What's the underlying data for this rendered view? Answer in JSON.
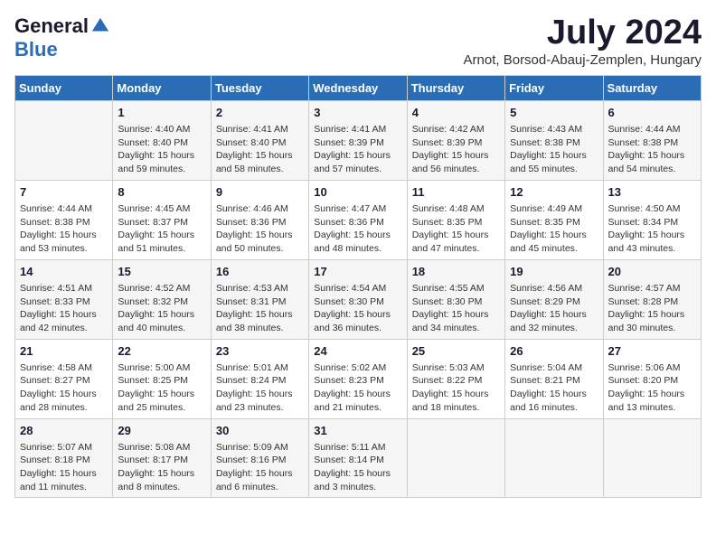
{
  "header": {
    "logo_general": "General",
    "logo_blue": "Blue",
    "month_title": "July 2024",
    "location": "Arnot, Borsod-Abauj-Zemplen, Hungary"
  },
  "days_of_week": [
    "Sunday",
    "Monday",
    "Tuesday",
    "Wednesday",
    "Thursday",
    "Friday",
    "Saturday"
  ],
  "weeks": [
    [
      {
        "day": "",
        "info": ""
      },
      {
        "day": "1",
        "info": "Sunrise: 4:40 AM\nSunset: 8:40 PM\nDaylight: 15 hours\nand 59 minutes."
      },
      {
        "day": "2",
        "info": "Sunrise: 4:41 AM\nSunset: 8:40 PM\nDaylight: 15 hours\nand 58 minutes."
      },
      {
        "day": "3",
        "info": "Sunrise: 4:41 AM\nSunset: 8:39 PM\nDaylight: 15 hours\nand 57 minutes."
      },
      {
        "day": "4",
        "info": "Sunrise: 4:42 AM\nSunset: 8:39 PM\nDaylight: 15 hours\nand 56 minutes."
      },
      {
        "day": "5",
        "info": "Sunrise: 4:43 AM\nSunset: 8:38 PM\nDaylight: 15 hours\nand 55 minutes."
      },
      {
        "day": "6",
        "info": "Sunrise: 4:44 AM\nSunset: 8:38 PM\nDaylight: 15 hours\nand 54 minutes."
      }
    ],
    [
      {
        "day": "7",
        "info": "Sunrise: 4:44 AM\nSunset: 8:38 PM\nDaylight: 15 hours\nand 53 minutes."
      },
      {
        "day": "8",
        "info": "Sunrise: 4:45 AM\nSunset: 8:37 PM\nDaylight: 15 hours\nand 51 minutes."
      },
      {
        "day": "9",
        "info": "Sunrise: 4:46 AM\nSunset: 8:36 PM\nDaylight: 15 hours\nand 50 minutes."
      },
      {
        "day": "10",
        "info": "Sunrise: 4:47 AM\nSunset: 8:36 PM\nDaylight: 15 hours\nand 48 minutes."
      },
      {
        "day": "11",
        "info": "Sunrise: 4:48 AM\nSunset: 8:35 PM\nDaylight: 15 hours\nand 47 minutes."
      },
      {
        "day": "12",
        "info": "Sunrise: 4:49 AM\nSunset: 8:35 PM\nDaylight: 15 hours\nand 45 minutes."
      },
      {
        "day": "13",
        "info": "Sunrise: 4:50 AM\nSunset: 8:34 PM\nDaylight: 15 hours\nand 43 minutes."
      }
    ],
    [
      {
        "day": "14",
        "info": "Sunrise: 4:51 AM\nSunset: 8:33 PM\nDaylight: 15 hours\nand 42 minutes."
      },
      {
        "day": "15",
        "info": "Sunrise: 4:52 AM\nSunset: 8:32 PM\nDaylight: 15 hours\nand 40 minutes."
      },
      {
        "day": "16",
        "info": "Sunrise: 4:53 AM\nSunset: 8:31 PM\nDaylight: 15 hours\nand 38 minutes."
      },
      {
        "day": "17",
        "info": "Sunrise: 4:54 AM\nSunset: 8:30 PM\nDaylight: 15 hours\nand 36 minutes."
      },
      {
        "day": "18",
        "info": "Sunrise: 4:55 AM\nSunset: 8:30 PM\nDaylight: 15 hours\nand 34 minutes."
      },
      {
        "day": "19",
        "info": "Sunrise: 4:56 AM\nSunset: 8:29 PM\nDaylight: 15 hours\nand 32 minutes."
      },
      {
        "day": "20",
        "info": "Sunrise: 4:57 AM\nSunset: 8:28 PM\nDaylight: 15 hours\nand 30 minutes."
      }
    ],
    [
      {
        "day": "21",
        "info": "Sunrise: 4:58 AM\nSunset: 8:27 PM\nDaylight: 15 hours\nand 28 minutes."
      },
      {
        "day": "22",
        "info": "Sunrise: 5:00 AM\nSunset: 8:25 PM\nDaylight: 15 hours\nand 25 minutes."
      },
      {
        "day": "23",
        "info": "Sunrise: 5:01 AM\nSunset: 8:24 PM\nDaylight: 15 hours\nand 23 minutes."
      },
      {
        "day": "24",
        "info": "Sunrise: 5:02 AM\nSunset: 8:23 PM\nDaylight: 15 hours\nand 21 minutes."
      },
      {
        "day": "25",
        "info": "Sunrise: 5:03 AM\nSunset: 8:22 PM\nDaylight: 15 hours\nand 18 minutes."
      },
      {
        "day": "26",
        "info": "Sunrise: 5:04 AM\nSunset: 8:21 PM\nDaylight: 15 hours\nand 16 minutes."
      },
      {
        "day": "27",
        "info": "Sunrise: 5:06 AM\nSunset: 8:20 PM\nDaylight: 15 hours\nand 13 minutes."
      }
    ],
    [
      {
        "day": "28",
        "info": "Sunrise: 5:07 AM\nSunset: 8:18 PM\nDaylight: 15 hours\nand 11 minutes."
      },
      {
        "day": "29",
        "info": "Sunrise: 5:08 AM\nSunset: 8:17 PM\nDaylight: 15 hours\nand 8 minutes."
      },
      {
        "day": "30",
        "info": "Sunrise: 5:09 AM\nSunset: 8:16 PM\nDaylight: 15 hours\nand 6 minutes."
      },
      {
        "day": "31",
        "info": "Sunrise: 5:11 AM\nSunset: 8:14 PM\nDaylight: 15 hours\nand 3 minutes."
      },
      {
        "day": "",
        "info": ""
      },
      {
        "day": "",
        "info": ""
      },
      {
        "day": "",
        "info": ""
      }
    ]
  ]
}
